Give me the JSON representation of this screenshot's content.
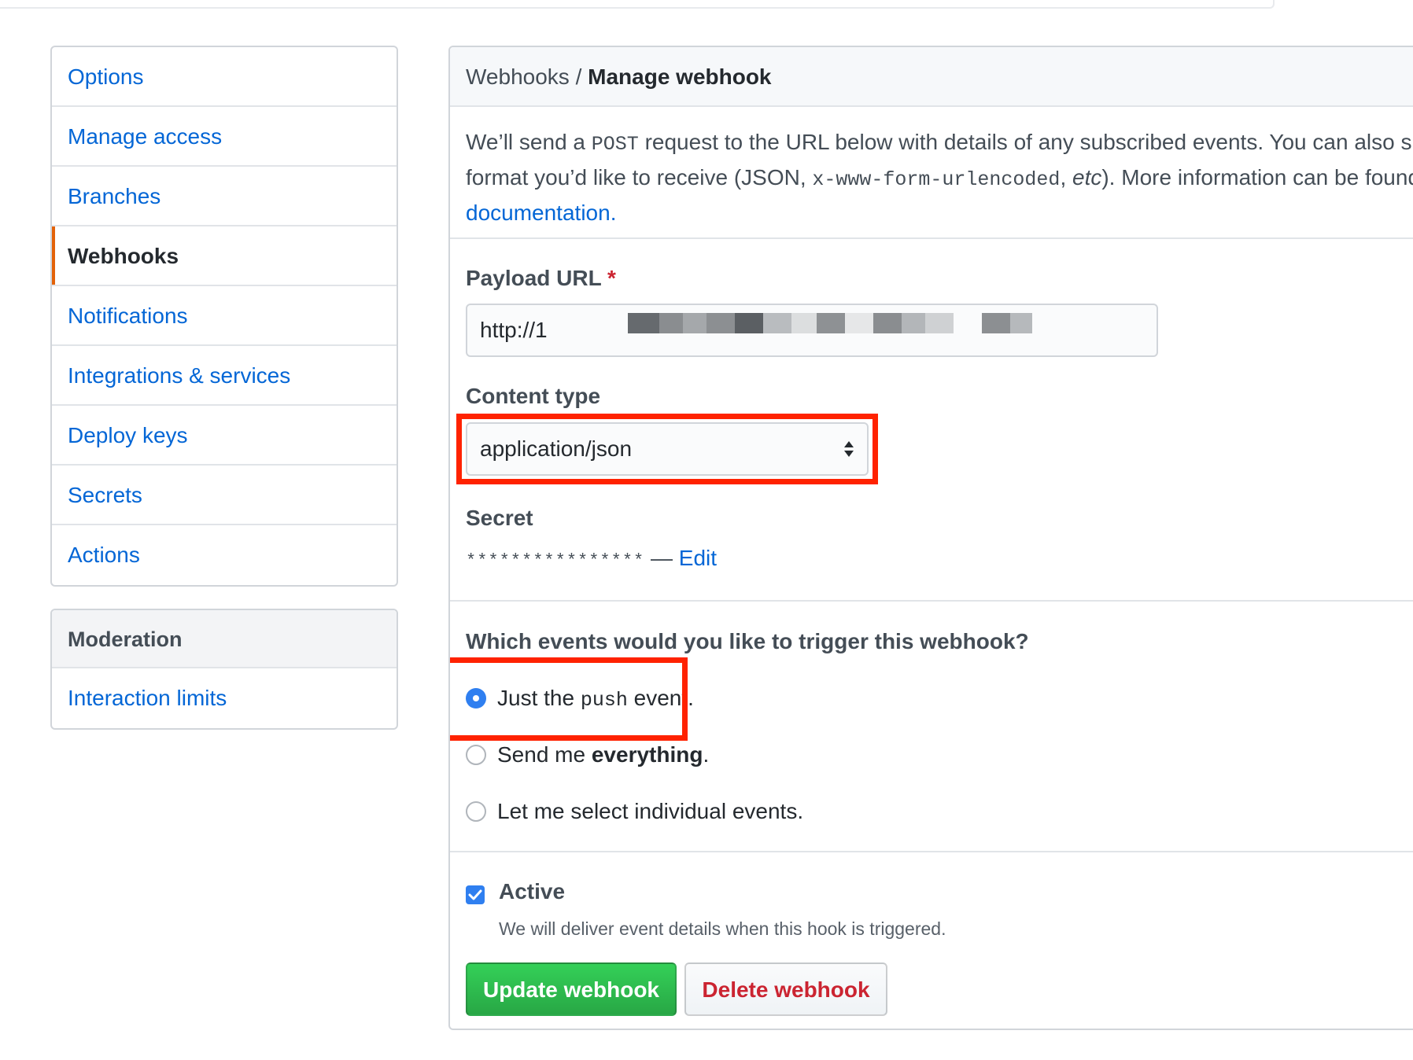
{
  "sidebar": {
    "items": [
      {
        "label": "Options"
      },
      {
        "label": "Manage access"
      },
      {
        "label": "Branches"
      },
      {
        "label": "Webhooks",
        "selected": true
      },
      {
        "label": "Notifications"
      },
      {
        "label": "Integrations & services"
      },
      {
        "label": "Deploy keys"
      },
      {
        "label": "Secrets"
      },
      {
        "label": "Actions"
      }
    ],
    "moderation": {
      "heading": "Moderation",
      "items": [
        {
          "label": "Interaction limits"
        }
      ]
    }
  },
  "header": {
    "breadcrumb_parent": "Webhooks",
    "separator": " / ",
    "breadcrumb_current": "Manage webhook"
  },
  "description": {
    "part1": "We’ll send a ",
    "method": "POST",
    "part2": " request to the URL below with details of any subscribed events. You can also spe",
    "part3": "format you’d like to receive (JSON, ",
    "encoding": "x-www-form-urlencoded",
    "part4": ", ",
    "etc": "etc",
    "part5": "). More information can be found ir",
    "link": "documentation",
    "end": "."
  },
  "form": {
    "payload_url_label": "Payload URL",
    "required_marker": "*",
    "payload_url_prefix": "http://1",
    "payload_url_suffix": "spr",
    "content_type_label": "Content type",
    "content_type_value": "application/json",
    "secret_label": "Secret",
    "secret_mask": "****************",
    "secret_dash": " — ",
    "secret_edit": "Edit"
  },
  "events": {
    "question": "Which events would you like to trigger this webhook?",
    "options": [
      {
        "pre": "Just the ",
        "code": "push",
        "post": " event.",
        "checked": true
      },
      {
        "pre": "Send me ",
        "bold": "everything",
        "post": ".",
        "checked": false
      },
      {
        "label": "Let me select individual events.",
        "checked": false
      }
    ]
  },
  "active": {
    "label": "Active",
    "checked": true,
    "note": "We will deliver event details when this hook is triggered."
  },
  "buttons": {
    "update": "Update webhook",
    "delete": "Delete webhook"
  },
  "colors": {
    "link": "#0366d6",
    "highlight": "#ff2200",
    "primary": "#28a745",
    "danger": "#cb2431",
    "selected_indicator": "#e36209"
  }
}
